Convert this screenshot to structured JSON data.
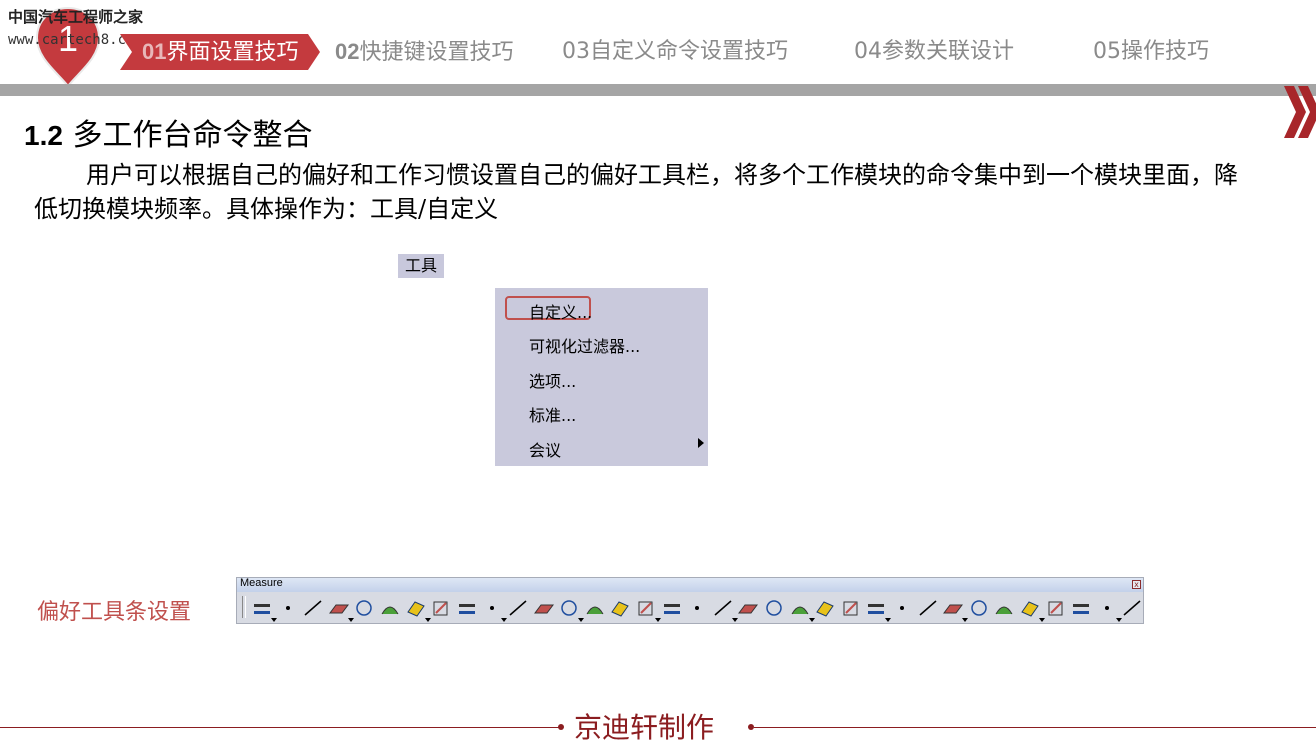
{
  "header": {
    "section_number": "1",
    "watermark_cn": "中国汽车工程师之家",
    "watermark_url": "www.cartech8.com",
    "tabs": [
      {
        "num": "01",
        "label": "界面设置技巧",
        "active": true
      },
      {
        "num": "02",
        "label": "快捷键设置技巧",
        "active": false
      },
      {
        "num": "03",
        "label": "自定义命令设置技巧",
        "active": false
      },
      {
        "num": "04",
        "label": "参数关联设计",
        "active": false
      },
      {
        "num": "05",
        "label": "操作技巧",
        "active": false
      }
    ]
  },
  "section": {
    "number": "1.2",
    "title": "多工作台命令整合",
    "paragraph": "用户可以根据自己的偏好和工作习惯设置自己的偏好工具栏，将多个工作模块的命令集中到一个模块里面，降低切换模块频率。具体操作为：工具/自定义"
  },
  "menu": {
    "title": "工具",
    "items": [
      "自定义...",
      "可视化过滤器...",
      "选项...",
      "标准...",
      "会议"
    ],
    "highlighted_item": "自定义..."
  },
  "toolbar": {
    "caption": "偏好工具条设置",
    "title": "Measure",
    "close_glyph": "x",
    "icons": [
      "measure-between-icon",
      "point-icon",
      "line-icon",
      "plane-icon",
      "circle-icon",
      "sketch-icon",
      "extrude-icon",
      "revolve-icon",
      "sketcher-icon",
      "sweep-icon",
      "fill-icon",
      "loft-icon",
      "offset-icon",
      "blend-icon",
      "pattern-icon",
      "curve-icon",
      "arc-icon",
      "spline-icon",
      "surface-icon",
      "split-icon",
      "trim-icon",
      "join-icon",
      "fillet-icon",
      "rectangle-icon",
      "3d-curve-icon",
      "paint-icon",
      "scatter-icon",
      "filter-icon",
      "connect-icon",
      "analysis-icon",
      "texture-icon",
      "color-icon",
      "globe-icon",
      "cube-icon",
      "bottle-icon"
    ],
    "colors": {
      "accent_red": "#c0504d",
      "blue": "#1f4e9f",
      "green": "#4aa03a",
      "yellow": "#e8c21a"
    }
  },
  "footer": {
    "text": "京迪轩制作"
  },
  "colors": {
    "brand_red": "#c43a3e",
    "footer_red": "#8b1d20",
    "tab_gray": "#8a8a8a",
    "menu_bg": "#c9c9dc"
  }
}
